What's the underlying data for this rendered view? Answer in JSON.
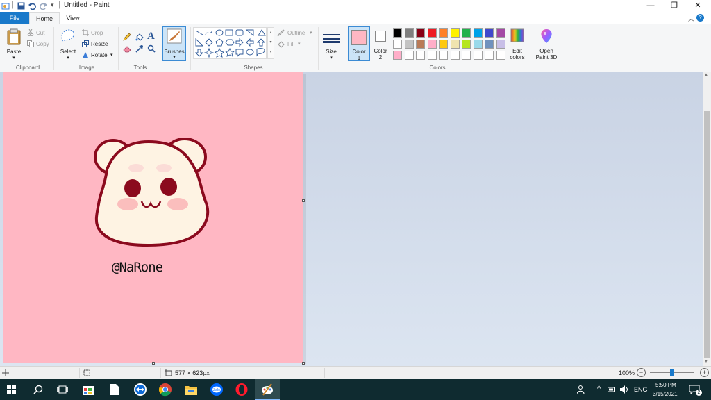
{
  "window": {
    "title": "Untitled - Paint",
    "qa_divider": "|",
    "qa_dropdown": "▾",
    "minimize": "—",
    "maximize": "❐",
    "close": "✕",
    "help": "?",
    "ribbon_collapse": "︿"
  },
  "tabs": [
    {
      "label": "File",
      "active": false
    },
    {
      "label": "Home",
      "active": true
    },
    {
      "label": "View",
      "active": false
    }
  ],
  "ribbon": {
    "clipboard": {
      "group_label": "Clipboard",
      "paste": "Paste",
      "cut": "Cut",
      "copy": "Copy"
    },
    "image": {
      "group_label": "Image",
      "select": "Select",
      "crop": "Crop",
      "resize": "Resize",
      "rotate": "Rotate"
    },
    "tools": {
      "group_label": "Tools"
    },
    "brushes": {
      "label": "Brushes"
    },
    "shapes": {
      "group_label": "Shapes",
      "outline": "Outline",
      "fill": "Fill"
    },
    "size": {
      "label": "Size"
    },
    "color1": {
      "label": "Color",
      "num": "1",
      "color": "#ffb7c3"
    },
    "color2": {
      "label": "Color",
      "num": "2",
      "color": "#ffffff"
    },
    "colors": {
      "group_label": "Colors",
      "row1": [
        "#000000",
        "#7f7f7f",
        "#880015",
        "#ed1c24",
        "#ff7f27",
        "#fff200",
        "#22b14c",
        "#00a2e8",
        "#3f48cc",
        "#a349a4"
      ],
      "row2": [
        "#ffffff",
        "#c3c3c3",
        "#b97a57",
        "#ffaec9",
        "#ffc90e",
        "#efe4b0",
        "#b5e61d",
        "#99d9ea",
        "#7092be",
        "#c8bfe7"
      ],
      "row3": [
        "#ffaec9",
        "#ffffff",
        "#ffffff",
        "#ffffff",
        "#ffffff",
        "#ffffff",
        "#ffffff",
        "#ffffff",
        "#ffffff",
        "#ffffff"
      ]
    },
    "edit_colors": {
      "line1": "Edit",
      "line2": "colors"
    },
    "open_paint3d": {
      "line1": "Open",
      "line2": "Paint 3D"
    }
  },
  "canvas": {
    "background": "#ffb7c3",
    "signature": "@NaRone"
  },
  "statusbar": {
    "dimensions": "577 × 623px",
    "zoom": "100%",
    "zoom_out": "−",
    "zoom_in": "+"
  },
  "taskbar": {
    "language": "ENG",
    "time": "5:50 PM",
    "date": "3/15/2021",
    "notifications": "2"
  }
}
